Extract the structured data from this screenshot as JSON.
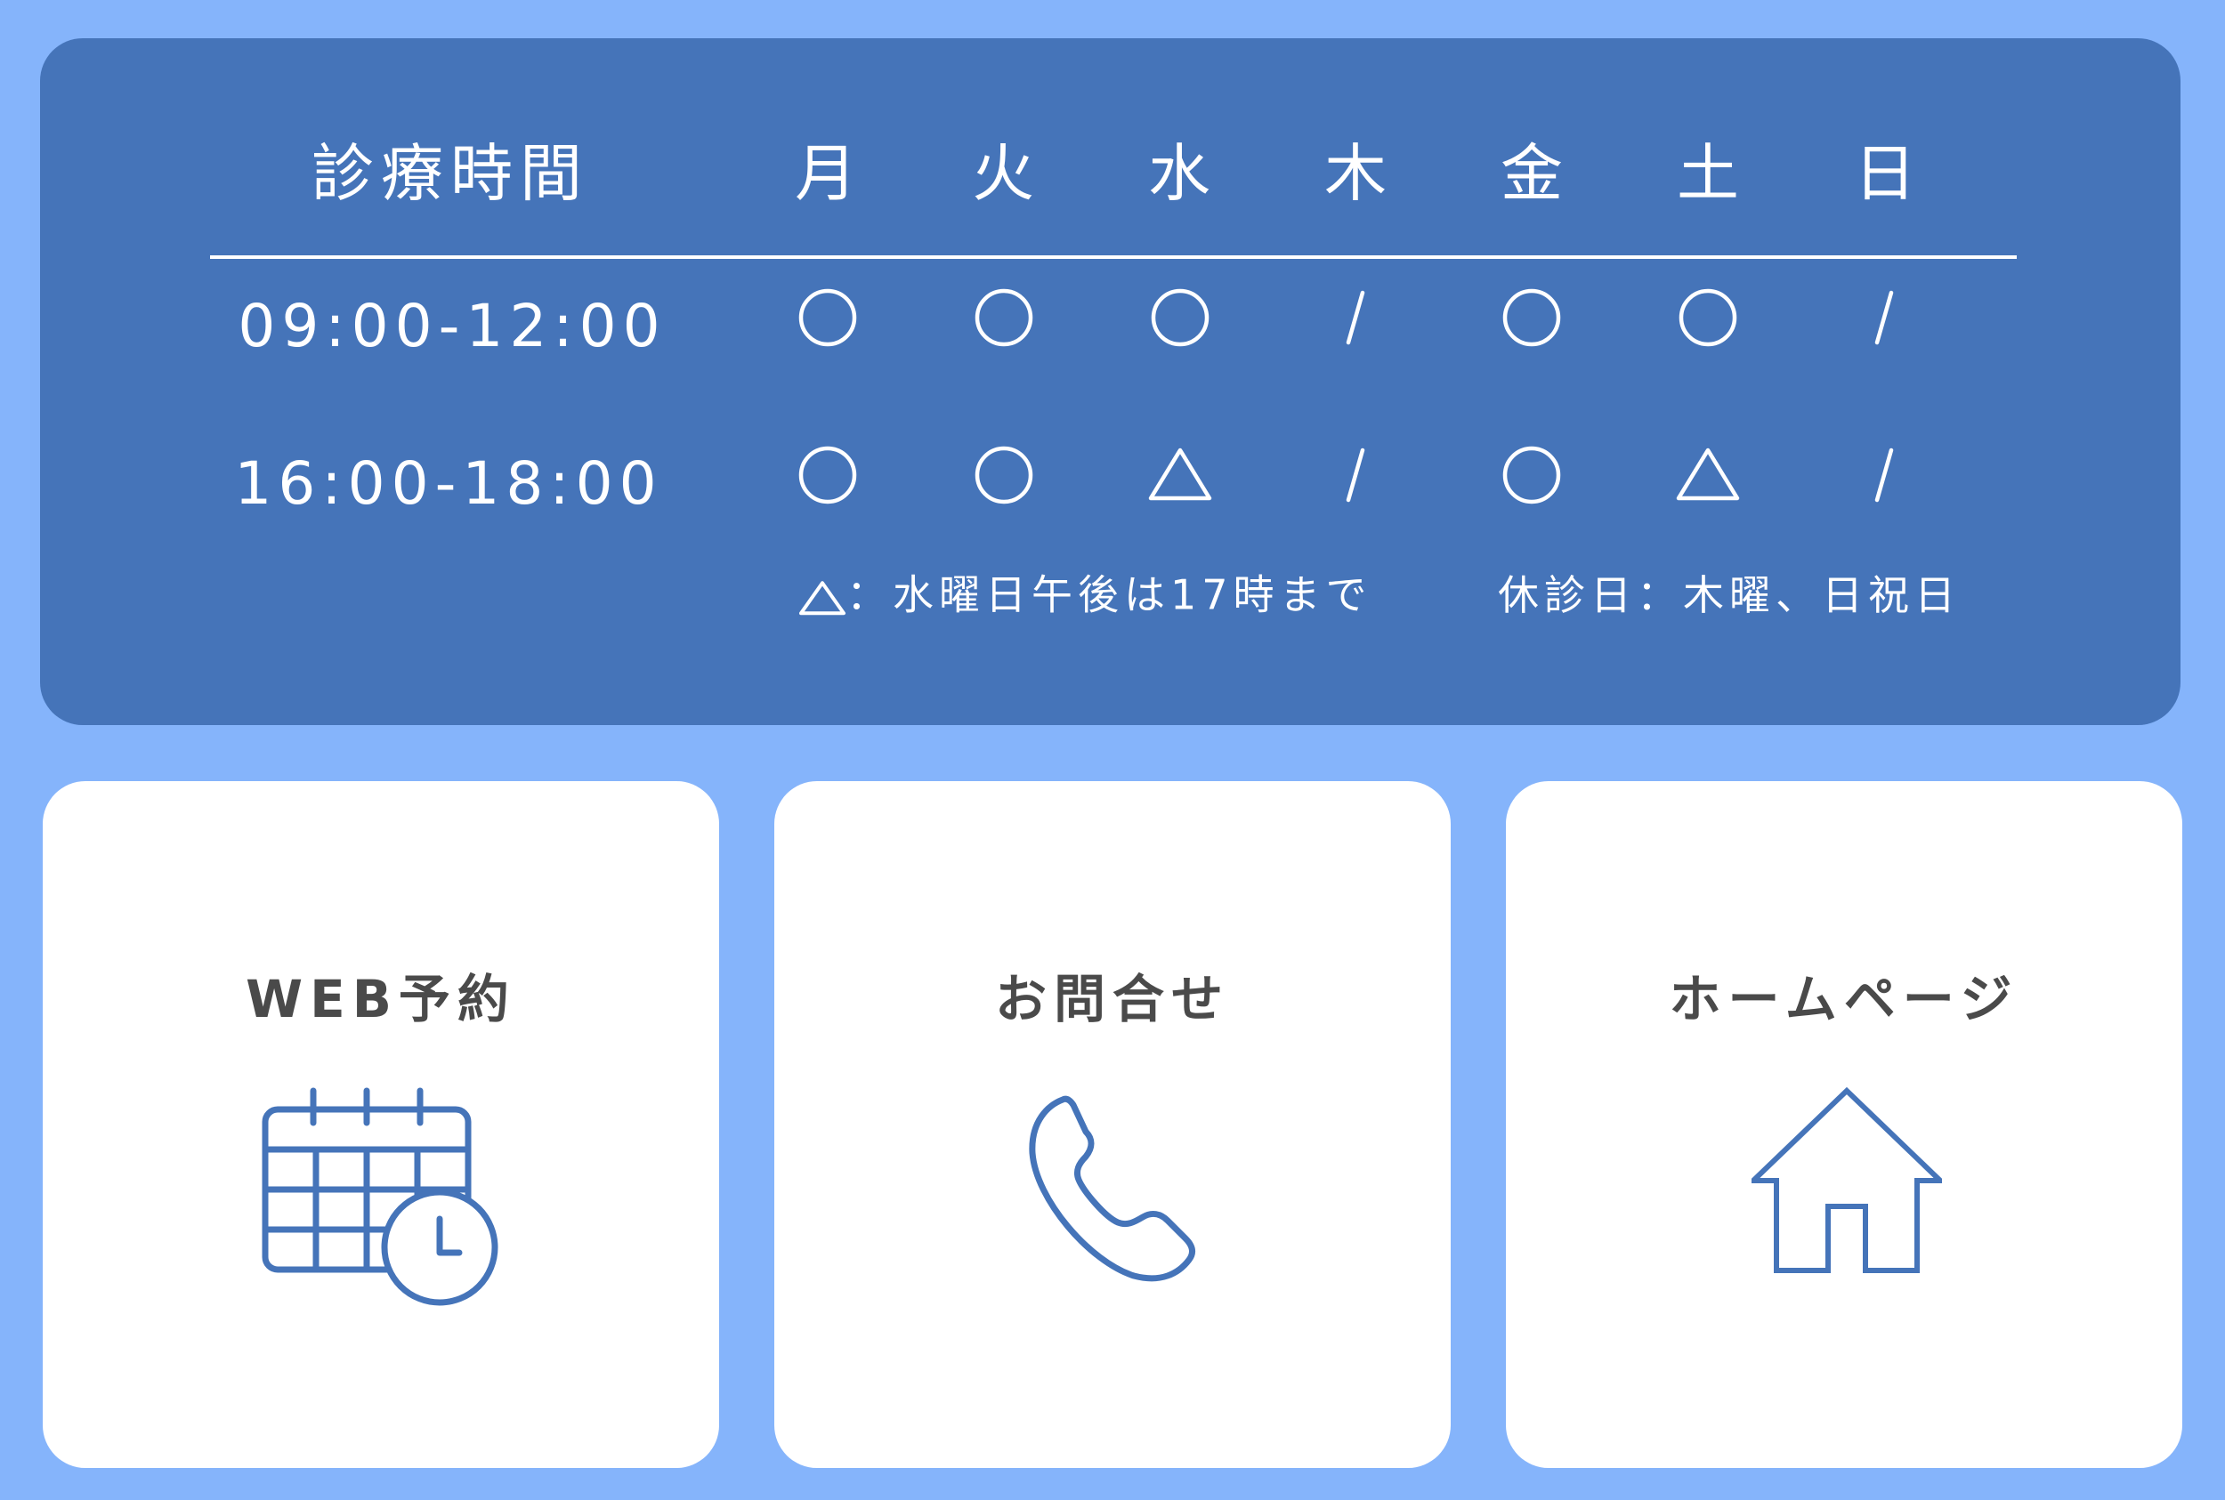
{
  "schedule": {
    "title": "診療時間",
    "days": [
      "月",
      "火",
      "水",
      "木",
      "金",
      "土",
      "日"
    ],
    "rows": [
      {
        "time": "09:00-12:00",
        "marks": [
          "circle",
          "circle",
          "circle",
          "slash",
          "circle",
          "circle",
          "slash"
        ]
      },
      {
        "time": "16:00-18:00",
        "marks": [
          "circle",
          "circle",
          "triangle",
          "slash",
          "circle",
          "triangle",
          "slash"
        ]
      }
    ],
    "note_wednesday": "：水曜日午後は17時まで",
    "note_closed": "休診日：木曜、日祝日"
  },
  "links": [
    {
      "label": "WEB予約",
      "icon": "calendar-clock-icon"
    },
    {
      "label": "お問合せ",
      "icon": "phone-icon"
    },
    {
      "label": "ホームページ",
      "icon": "home-icon"
    }
  ],
  "colors": {
    "background": "#85b4fb",
    "panel": "#4574b9",
    "card": "#ffffff",
    "icon_stroke": "#4574b9",
    "label_text": "#4a4a4a"
  }
}
